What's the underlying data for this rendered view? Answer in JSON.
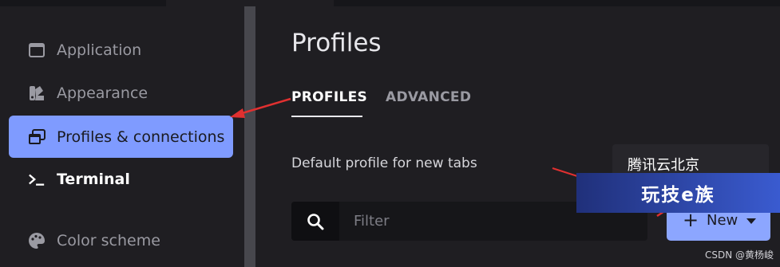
{
  "sidebar": {
    "items": [
      {
        "label": "Application",
        "icon": "window-icon",
        "state": "normal"
      },
      {
        "label": "Appearance",
        "icon": "palette-brush-icon",
        "state": "normal"
      },
      {
        "label": "Profiles & connections",
        "icon": "stacked-windows-icon",
        "state": "active"
      },
      {
        "label": "Terminal",
        "icon": "terminal-prompt-icon",
        "state": "bright"
      },
      {
        "label": "Color scheme",
        "icon": "palette-icon",
        "state": "normal"
      }
    ]
  },
  "main": {
    "title": "Profiles",
    "tabs": [
      {
        "label": "PROFILES",
        "selected": true
      },
      {
        "label": "ADVANCED",
        "selected": false
      }
    ],
    "default_profile_label": "Default profile for new tabs",
    "default_profile_value": "腾讯云北京",
    "search_placeholder": "Filter",
    "new_button_label": "New"
  },
  "overlay": {
    "watermark_text": "玩技e族",
    "credit_text": "CSDN @黄杨峻"
  },
  "colors": {
    "accent": "#7f9bff",
    "button": "#8ca6ff",
    "annotation_arrow": "#e03030"
  }
}
